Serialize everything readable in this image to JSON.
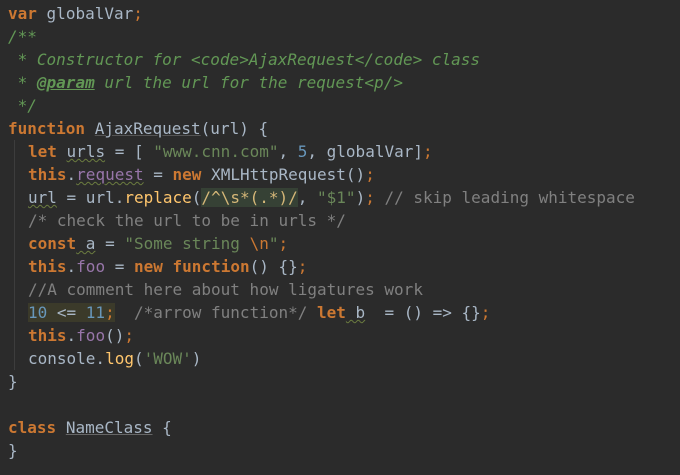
{
  "editor": {
    "theme_colors": {
      "background": "#2b2b2b",
      "keyword": "#cc7832",
      "string": "#6a8759",
      "number": "#6897bb",
      "comment": "#808080",
      "doc_comment": "#629755",
      "property": "#9876aa",
      "function_call": "#ffc66d",
      "text": "#a9b7c6"
    },
    "code": {
      "l1": {
        "kw": "var",
        "name": "globalVar",
        "semi": ";"
      },
      "l2": {
        "text": "/**"
      },
      "l3": {
        "text": " * Constructor for <code>AjaxRequest</code> class"
      },
      "l4": {
        "star": " * ",
        "tag": "@param",
        "rest": " url the url for the request<p/>"
      },
      "l5": {
        "text": " */"
      },
      "l6": {
        "kw": "function",
        "name": "AjaxRequest",
        "params": "(url) {"
      },
      "l7": {
        "kw": "let",
        "name": "urls",
        "eq": " = [ ",
        "s1": "\"www.cnn.com\"",
        "c1": ", ",
        "n1": "5",
        "c2": ", ",
        "g": "globalVar",
        "close": "]",
        "semi": ";"
      },
      "l8": {
        "this": "this",
        "dot": ".",
        "prop": "request",
        "eq": " = ",
        "kw": "new",
        "cls": " XMLHttpRequest()",
        "semi": ";"
      },
      "l9": {
        "v": "url",
        "eq": " = url.",
        "fn": "replace",
        "p1": "(",
        "r1": "/",
        "r2": "^\\s*(.*)",
        "r3": "/",
        "c": ", ",
        "s": "\"$1\"",
        "p2": ")",
        "semi": ";",
        "cmt": " // skip leading whitespace"
      },
      "l10": {
        "text": "/* check the url to be in urls */"
      },
      "l11": {
        "kw": "const",
        "v": " a",
        "eq": " = ",
        "s": "\"Some string ",
        "esc": "\\n",
        "s2": "\"",
        "semi": ";"
      },
      "l12": {
        "this": "this",
        "dot": ".",
        "prop": "foo",
        "eq": " = ",
        "kw": "new",
        "kw2": "function",
        "rest": "() {}",
        "semi": ";"
      },
      "l13": {
        "text": "//A comment here about how ligatures work"
      },
      "l14": {
        "n1": "10",
        "op": " <= ",
        "n2": "11",
        "semi": ";",
        "gap": "  ",
        "cmt": "/*arrow function*/",
        "sp": " ",
        "kw": "let",
        "v": " b",
        "rest": "  = () => {}",
        "semi2": ";"
      },
      "l15": {
        "this": "this",
        "dot": ".",
        "fn": "foo",
        "rest": "()",
        "semi": ";"
      },
      "l16": {
        "obj": "console.",
        "fn": "log",
        "p1": "(",
        "s": "'WOW'",
        "p2": ")"
      },
      "l17": {
        "text": "}"
      },
      "l19": {
        "kw": "class",
        "name": "NameClass",
        "rest": " {"
      },
      "l20": {
        "text": "}"
      }
    }
  }
}
